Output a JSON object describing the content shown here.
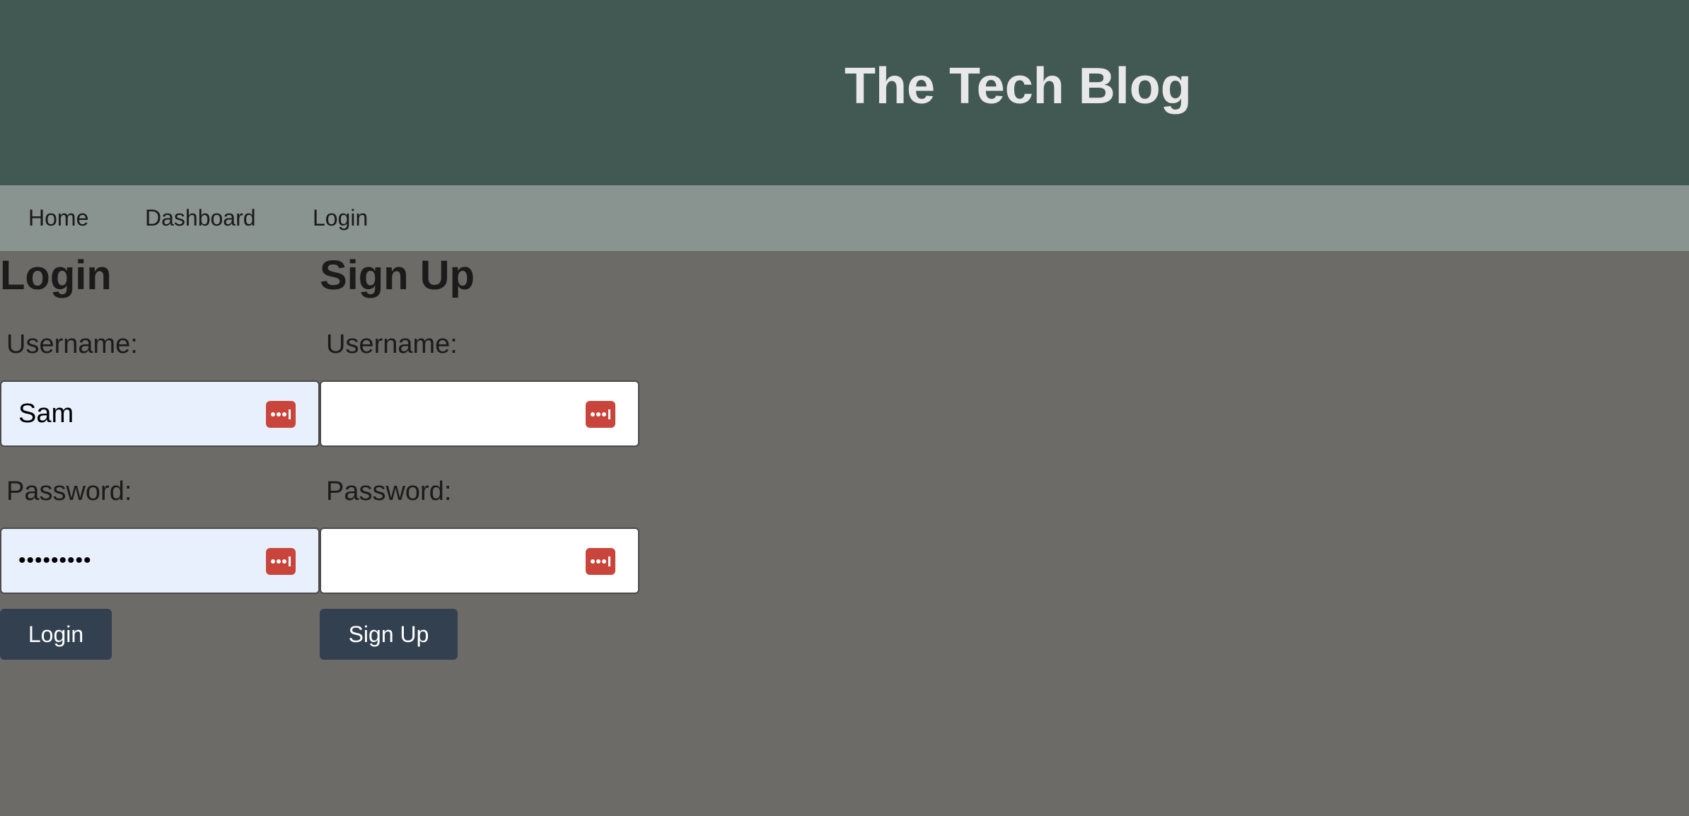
{
  "header": {
    "title": "The Tech Blog"
  },
  "nav": {
    "items": [
      {
        "label": "Home"
      },
      {
        "label": "Dashboard"
      },
      {
        "label": "Login"
      }
    ]
  },
  "login_form": {
    "title": "Login",
    "username_label": "Username:",
    "username_value": "Sam",
    "password_label": "Password:",
    "password_value": "password1",
    "submit_label": "Login"
  },
  "signup_form": {
    "title": "Sign Up",
    "username_label": "Username:",
    "username_value": "",
    "password_label": "Password:",
    "password_value": "",
    "submit_label": "Sign Up"
  },
  "icons": {
    "password_manager": "password-manager-icon"
  },
  "colors": {
    "header_bg": "#425953",
    "nav_bg": "#89938f",
    "page_bg": "#6c6b67",
    "button_bg": "#32404f",
    "autofill_bg": "#e8f0fd",
    "icon_red": "#c9443b"
  }
}
